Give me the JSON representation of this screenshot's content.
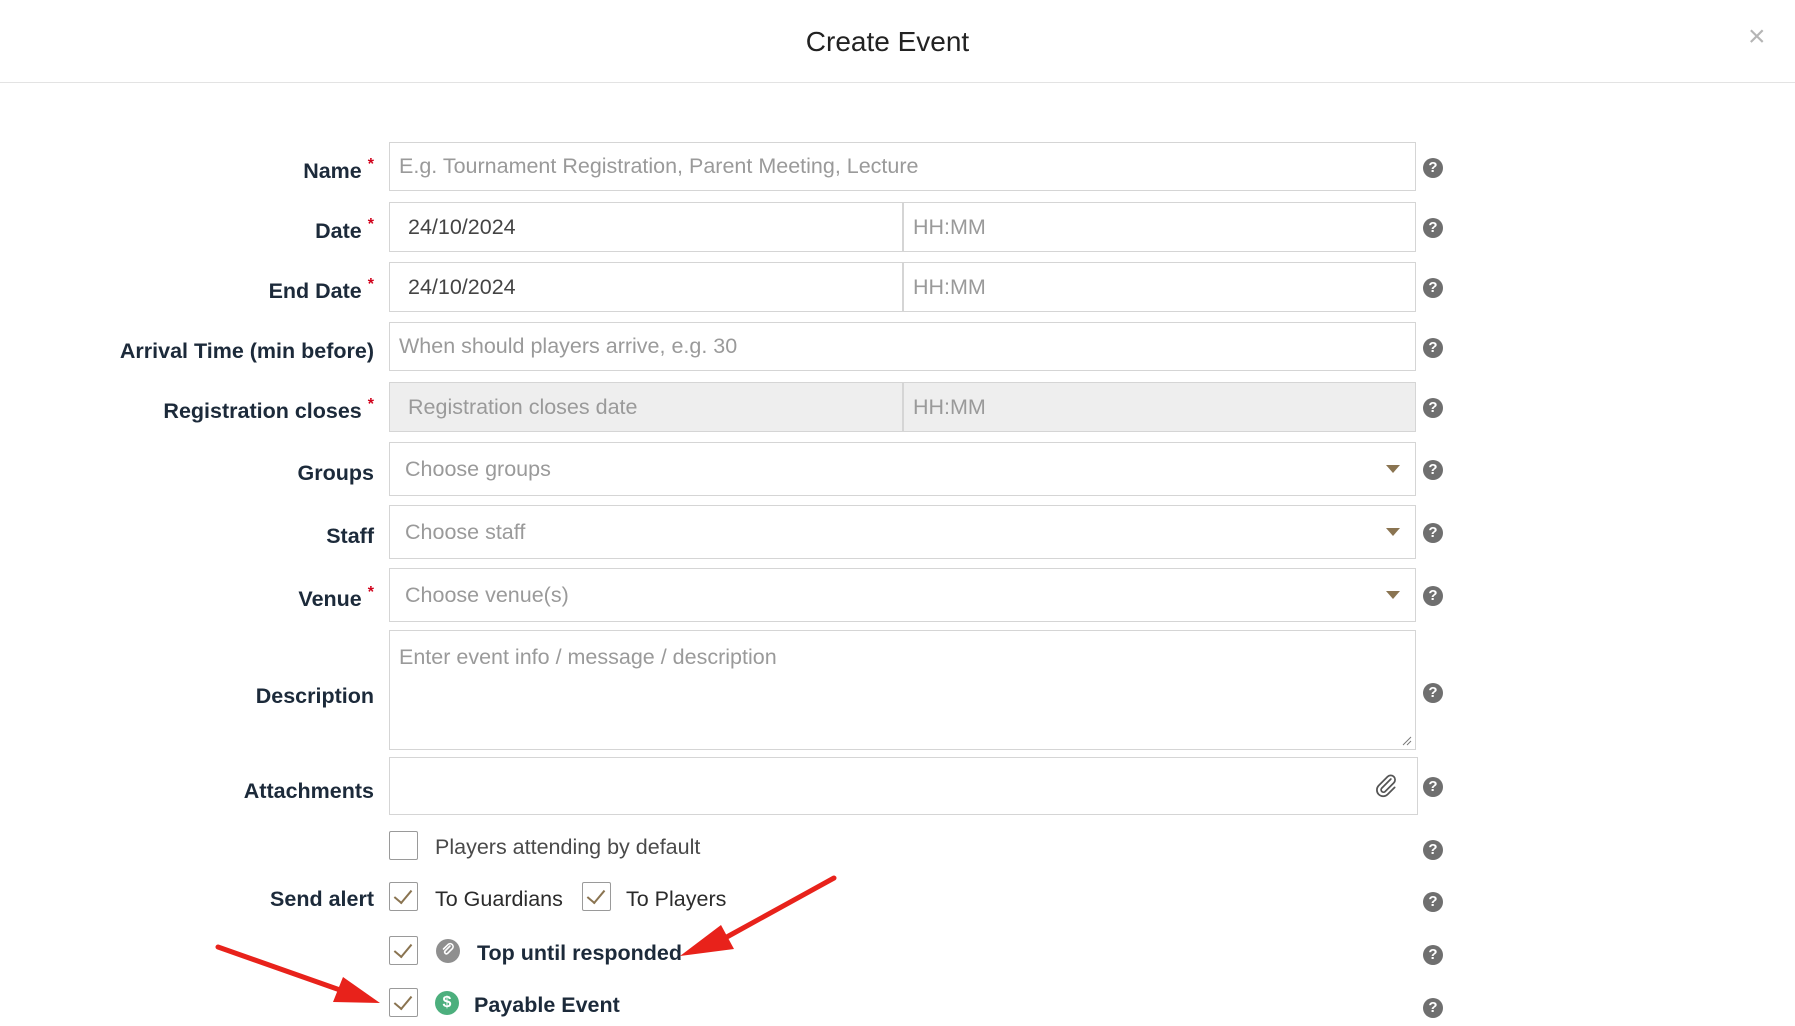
{
  "dialog": {
    "title": "Create Event",
    "close_label": "×"
  },
  "fields": {
    "name": {
      "label": "Name",
      "placeholder": "E.g. Tournament Registration, Parent Meeting, Lecture",
      "value": ""
    },
    "date": {
      "label": "Date",
      "date_value": "24/10/2024",
      "time_placeholder": "HH:MM"
    },
    "end_date": {
      "label": "End Date",
      "date_value": "24/10/2024",
      "time_placeholder": "HH:MM"
    },
    "arrival_time": {
      "label": "Arrival Time (min before)",
      "placeholder": "When should players arrive, e.g. 30"
    },
    "registration_closes": {
      "label": "Registration closes",
      "date_placeholder": "Registration closes date",
      "time_placeholder": "HH:MM"
    },
    "groups": {
      "label": "Groups",
      "placeholder": "Choose groups"
    },
    "staff": {
      "label": "Staff",
      "placeholder": "Choose staff"
    },
    "venue": {
      "label": "Venue",
      "placeholder": "Choose venue(s)"
    },
    "description": {
      "label": "Description",
      "placeholder": "Enter event info / message / description"
    },
    "attachments": {
      "label": "Attachments"
    }
  },
  "required_marker": "*",
  "help_glyph": "?",
  "options": {
    "players_attending": {
      "label": "Players attending by default",
      "checked": false
    },
    "send_alert": {
      "label": "Send alert",
      "to_guardians": {
        "label": "To Guardians",
        "checked": true
      },
      "to_players": {
        "label": "To Players",
        "checked": true
      }
    },
    "top_until_responded": {
      "label": "Top until responded",
      "checked": true,
      "icon": "pin-icon"
    },
    "payable_event": {
      "label": "Payable Event",
      "checked": true,
      "icon": "dollar-icon"
    }
  },
  "colors": {
    "accent": "#8a7451",
    "required": "#d0021b",
    "annotation_arrow": "#e8221b",
    "dollar_icon": "#4caf7d"
  }
}
